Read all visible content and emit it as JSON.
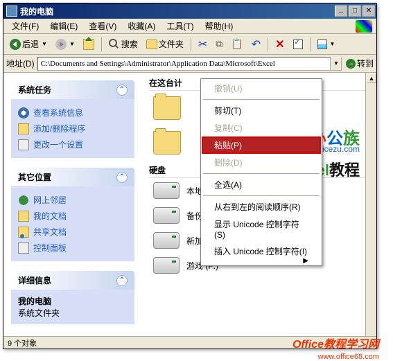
{
  "titlebar": {
    "title": "我的电脑"
  },
  "menubar": {
    "file": "文件(F)",
    "edit": "编辑(E)",
    "view": "查看(V)",
    "favorites": "收藏(A)",
    "tools": "工具(T)",
    "help": "帮助(H)"
  },
  "toolbar": {
    "back": "后退",
    "search": "搜索",
    "folders": "文件夹"
  },
  "addressbar": {
    "label": "地址(D)",
    "path": "C:\\Documents and Settings\\Administrator\\Application Data\\Microsoft\\Excel",
    "go": "转到"
  },
  "sidebar": {
    "tasks": {
      "title": "系统任务",
      "items": [
        "查看系统信息",
        "添加/删除程序",
        "更改一个设置"
      ]
    },
    "other": {
      "title": "其它位置",
      "items": [
        "网上邻居",
        "我的文档",
        "共享文档",
        "控制面板"
      ]
    },
    "details": {
      "title": "详细信息",
      "name": "我的电脑",
      "type": "系统文件夹"
    }
  },
  "main": {
    "section1": "在这台计",
    "section2": "硬盘",
    "drives": [
      {
        "label": "本地磁盘 (C:)"
      },
      {
        "label": "备份 (D:)"
      },
      {
        "label": "新加卷 (E:)"
      },
      {
        "label": "游戏 (F:)"
      }
    ]
  },
  "context_menu": {
    "undo": "撤销(U)",
    "cut": "剪切(T)",
    "copy": "复制(C)",
    "paste": "粘贴(P)",
    "delete": "删除(D)",
    "select_all": "全选(A)",
    "rtl": "从右到左的阅读顺序(R)",
    "show_unicode": "显示 Unicode 控制字符(S)",
    "insert_unicode": "插入 Unicode 控制字符(I)"
  },
  "statusbar": {
    "text": "9 个对象"
  },
  "watermarks": {
    "w1a": "办",
    "w1b": "公",
    "w1c": "族",
    "w1sub": "officezu.com",
    "w2a": "Excel",
    "w2b": "教程",
    "w3": "Office教程学习网",
    "w3sub": "www.office68.com"
  }
}
